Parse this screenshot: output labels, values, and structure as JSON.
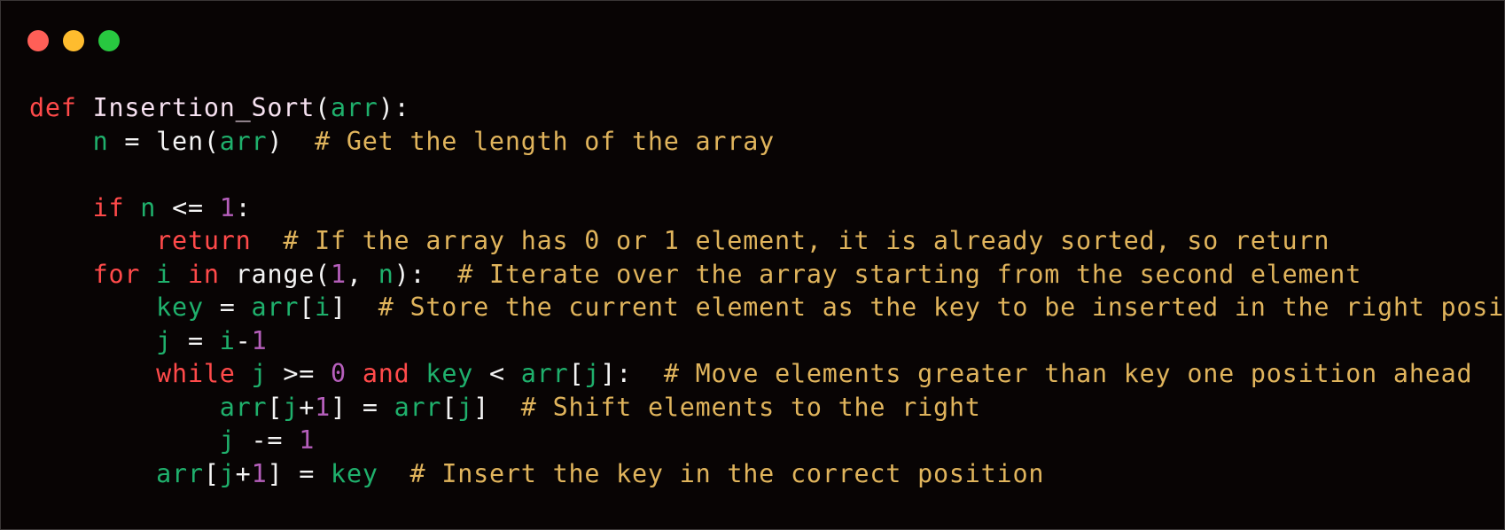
{
  "window": {
    "controls": [
      {
        "name": "close-button",
        "color": "#ff5f57"
      },
      {
        "name": "minimize-button",
        "color": "#febc2e"
      },
      {
        "name": "maximize-button",
        "color": "#28c840"
      }
    ]
  },
  "code": {
    "language": "python",
    "lines": [
      [
        {
          "t": "def",
          "c": "kw"
        },
        {
          "t": " ",
          "c": "op"
        },
        {
          "t": "Insertion_Sort",
          "c": "fn"
        },
        {
          "t": "(",
          "c": "op"
        },
        {
          "t": "arr",
          "c": "var"
        },
        {
          "t": "):",
          "c": "op"
        }
      ],
      [
        {
          "t": "    ",
          "c": "op"
        },
        {
          "t": "n",
          "c": "var"
        },
        {
          "t": " = len(",
          "c": "op"
        },
        {
          "t": "arr",
          "c": "var"
        },
        {
          "t": ")  ",
          "c": "op"
        },
        {
          "t": "# Get the length of the array",
          "c": "cm"
        }
      ],
      [],
      [
        {
          "t": "    ",
          "c": "op"
        },
        {
          "t": "if",
          "c": "kw"
        },
        {
          "t": " ",
          "c": "op"
        },
        {
          "t": "n",
          "c": "var"
        },
        {
          "t": " <= ",
          "c": "op"
        },
        {
          "t": "1",
          "c": "num"
        },
        {
          "t": ":",
          "c": "op"
        }
      ],
      [
        {
          "t": "        ",
          "c": "op"
        },
        {
          "t": "return",
          "c": "kw"
        },
        {
          "t": "  ",
          "c": "op"
        },
        {
          "t": "# If the array has 0 or 1 element, it is already sorted, so return",
          "c": "cm"
        }
      ],
      [
        {
          "t": "    ",
          "c": "op"
        },
        {
          "t": "for",
          "c": "kw"
        },
        {
          "t": " ",
          "c": "op"
        },
        {
          "t": "i",
          "c": "var"
        },
        {
          "t": " ",
          "c": "op"
        },
        {
          "t": "in",
          "c": "kw"
        },
        {
          "t": " range(",
          "c": "op"
        },
        {
          "t": "1",
          "c": "num"
        },
        {
          "t": ", ",
          "c": "op"
        },
        {
          "t": "n",
          "c": "var"
        },
        {
          "t": "):  ",
          "c": "op"
        },
        {
          "t": "# Iterate over the array starting from the second element",
          "c": "cm"
        }
      ],
      [
        {
          "t": "        ",
          "c": "op"
        },
        {
          "t": "key",
          "c": "var"
        },
        {
          "t": " = ",
          "c": "op"
        },
        {
          "t": "arr",
          "c": "var"
        },
        {
          "t": "[",
          "c": "op"
        },
        {
          "t": "i",
          "c": "var"
        },
        {
          "t": "]  ",
          "c": "op"
        },
        {
          "t": "# Store the current element as the key to be inserted in the right position",
          "c": "cm"
        }
      ],
      [
        {
          "t": "        ",
          "c": "op"
        },
        {
          "t": "j",
          "c": "var"
        },
        {
          "t": " = ",
          "c": "op"
        },
        {
          "t": "i",
          "c": "var"
        },
        {
          "t": "-",
          "c": "op"
        },
        {
          "t": "1",
          "c": "num"
        }
      ],
      [
        {
          "t": "        ",
          "c": "op"
        },
        {
          "t": "while",
          "c": "kw"
        },
        {
          "t": " ",
          "c": "op"
        },
        {
          "t": "j",
          "c": "var"
        },
        {
          "t": " >= ",
          "c": "op"
        },
        {
          "t": "0",
          "c": "num"
        },
        {
          "t": " ",
          "c": "op"
        },
        {
          "t": "and",
          "c": "kw"
        },
        {
          "t": " ",
          "c": "op"
        },
        {
          "t": "key",
          "c": "var"
        },
        {
          "t": " < ",
          "c": "op"
        },
        {
          "t": "arr",
          "c": "var"
        },
        {
          "t": "[",
          "c": "op"
        },
        {
          "t": "j",
          "c": "var"
        },
        {
          "t": "]:  ",
          "c": "op"
        },
        {
          "t": "# Move elements greater than key one position ahead",
          "c": "cm"
        }
      ],
      [
        {
          "t": "            ",
          "c": "op"
        },
        {
          "t": "arr",
          "c": "var"
        },
        {
          "t": "[",
          "c": "op"
        },
        {
          "t": "j",
          "c": "var"
        },
        {
          "t": "+",
          "c": "op"
        },
        {
          "t": "1",
          "c": "num"
        },
        {
          "t": "] = ",
          "c": "op"
        },
        {
          "t": "arr",
          "c": "var"
        },
        {
          "t": "[",
          "c": "op"
        },
        {
          "t": "j",
          "c": "var"
        },
        {
          "t": "]  ",
          "c": "op"
        },
        {
          "t": "# Shift elements to the right",
          "c": "cm"
        }
      ],
      [
        {
          "t": "            ",
          "c": "op"
        },
        {
          "t": "j",
          "c": "var"
        },
        {
          "t": " -= ",
          "c": "op"
        },
        {
          "t": "1",
          "c": "num"
        }
      ],
      [
        {
          "t": "        ",
          "c": "op"
        },
        {
          "t": "arr",
          "c": "var"
        },
        {
          "t": "[",
          "c": "op"
        },
        {
          "t": "j",
          "c": "var"
        },
        {
          "t": "+",
          "c": "op"
        },
        {
          "t": "1",
          "c": "num"
        },
        {
          "t": "] = ",
          "c": "op"
        },
        {
          "t": "key",
          "c": "var"
        },
        {
          "t": "  ",
          "c": "op"
        },
        {
          "t": "# Insert the key in the correct position",
          "c": "cm"
        }
      ]
    ]
  },
  "theme": {
    "background": "#080404",
    "keyword": "#ff4a4a",
    "function": "#f6e1f0",
    "variable": "#1fb06c",
    "number": "#b65fbc",
    "comment": "#e0b45c",
    "text": "#f4f4f4"
  }
}
